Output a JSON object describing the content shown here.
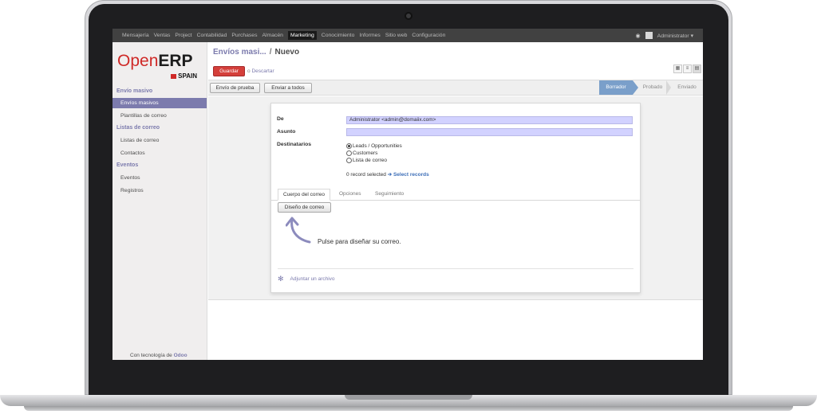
{
  "topbar": {
    "items": [
      "Mensajería",
      "Ventas",
      "Project",
      "Contabilidad",
      "Purchases",
      "Almacén",
      "Marketing",
      "Conocimiento",
      "Informes",
      "Sitio web",
      "Configuración"
    ],
    "active_index": 6,
    "user": "Administrator ▾",
    "chat_icon": "chat-icon"
  },
  "sidebar": {
    "logo_open": "Open",
    "logo_erp": "ERP",
    "logo_spain": "SPAIN",
    "section_envio": "Envío masivo",
    "item_envios": "Envíos masivos",
    "item_plantillas": "Plantillas de correo",
    "section_listas": "Listas de correo",
    "item_listas": "Listas de correo",
    "item_contactos": "Contactos",
    "section_eventos": "Eventos",
    "item_eventos": "Eventos",
    "item_registros": "Registros",
    "footer_prefix": "Con tecnología de",
    "footer_brand": "Odoo"
  },
  "header": {
    "breadcrumb_link": "Envíos masi...",
    "breadcrumb_sep": "/",
    "breadcrumb_current": "Nuevo",
    "save_label": "Guardar",
    "or_label": "o",
    "discard_label": "Descartar"
  },
  "statusbar": {
    "test_button": "Envío de prueba",
    "send_all_button": "Enviar a todos",
    "stages": [
      "Borrador",
      "Probado",
      "Enviado"
    ],
    "active_stage": 0
  },
  "form": {
    "de_label": "De",
    "de_value": "Administrator <admin@domaiix.com>",
    "asunto_label": "Asunto",
    "asunto_value": "",
    "destinatarios_label": "Destinatarios",
    "radio_options": [
      "Leads / Opportunities",
      "Customers",
      "Lista de correo"
    ],
    "radio_selected": 0,
    "records_text": "0 record selected",
    "select_records": "➔ Select records",
    "tabs": [
      "Cuerpo del correo",
      "Opciones",
      "Seguimiento"
    ],
    "active_tab": 0,
    "design_button": "Diseño de correo",
    "hint": "Pulse para diseñar su correo.",
    "attach_label": "Adjuntar un archivo"
  },
  "colors": {
    "accent": "#7c7bad",
    "save": "#d43f3a",
    "stage_active": "#7a9fca",
    "input_required": "#d2d2ff"
  }
}
